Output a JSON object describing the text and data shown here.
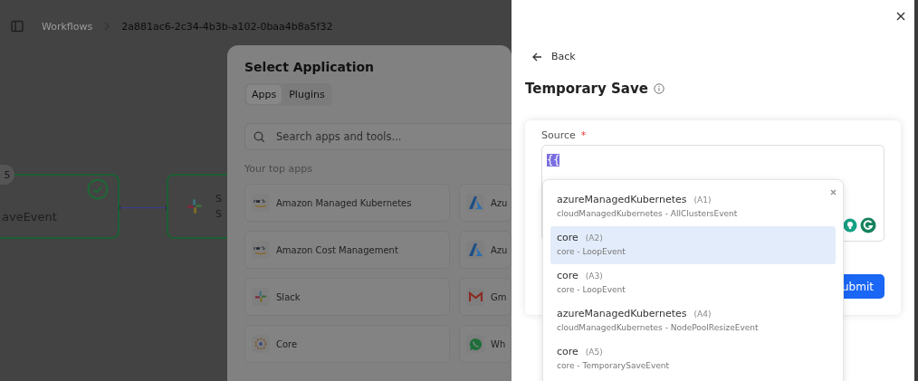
{
  "breadcrumb": [
    {
      "label": "Workflows",
      "current": false
    },
    {
      "label": "2a881ac6-2c34-4b3b-a102-0baa4b8a5f32",
      "current": true
    }
  ],
  "canvas": {
    "nodes": [
      {
        "kind": "event",
        "badge": "5",
        "title": "aveEvent",
        "done": true
      },
      {
        "kind": "app",
        "title": "S",
        "subtitle": "S"
      }
    ]
  },
  "modal": {
    "title": "Select Application",
    "tabs": [
      {
        "label": "Apps",
        "selected": true
      },
      {
        "label": "Plugins",
        "selected": false
      }
    ],
    "search": {
      "placeholder": "Search apps and tools..."
    },
    "section": "Your top apps",
    "apps": [
      {
        "name": "Amazon Managed Kubernetes",
        "kind": "aws"
      },
      {
        "name": "Azu",
        "kind": "azure"
      },
      {
        "name": "Amazon Cost Management",
        "kind": "aws"
      },
      {
        "name": "Azu",
        "kind": "azure"
      },
      {
        "name": "Slack",
        "kind": "slack"
      },
      {
        "name": "Gm",
        "kind": "gmail"
      },
      {
        "name": "Core",
        "kind": "core"
      },
      {
        "name": "Wh",
        "kind": "whatsapp"
      }
    ]
  },
  "panel": {
    "back": "Back",
    "title": "Temporary Save",
    "form": {
      "label": "Source",
      "required": true,
      "required_mark": "*",
      "value": "{{",
      "submit": "ubmit"
    },
    "suggestions": [
      {
        "name": "azureManagedKubernetes",
        "ref": "(A1)",
        "detail": "cloudManagedKubernetes - AllClustersEvent",
        "selected": false
      },
      {
        "name": "core",
        "ref": "(A2)",
        "detail": "core - LoopEvent",
        "selected": true
      },
      {
        "name": "core",
        "ref": "(A3)",
        "detail": "core - LoopEvent",
        "selected": false
      },
      {
        "name": "azureManagedKubernetes",
        "ref": "(A4)",
        "detail": "cloudManagedKubernetes - NodePoolResizeEvent",
        "selected": false
      },
      {
        "name": "core",
        "ref": "(A5)",
        "detail": "core - TemporarySaveEvent",
        "selected": false
      }
    ]
  }
}
